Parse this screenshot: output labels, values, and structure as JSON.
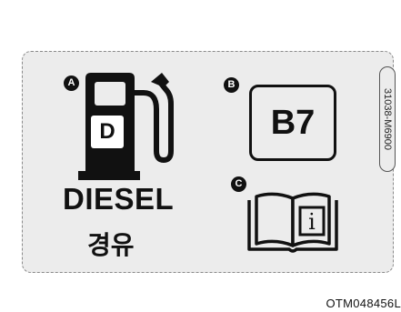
{
  "markers": {
    "a": "A",
    "b": "B",
    "c": "C"
  },
  "fuel_pump": {
    "letter": "D"
  },
  "fuel_type": {
    "english": "DIESEL",
    "korean": "경유"
  },
  "biodiesel_label": "B7",
  "manual_icon": {
    "symbol": "i"
  },
  "side_code": "31038-M6900",
  "figure_code": "OTM048456L",
  "colors": {
    "ink": "#111111",
    "panel": "#ececec",
    "background": "#ffffff"
  }
}
